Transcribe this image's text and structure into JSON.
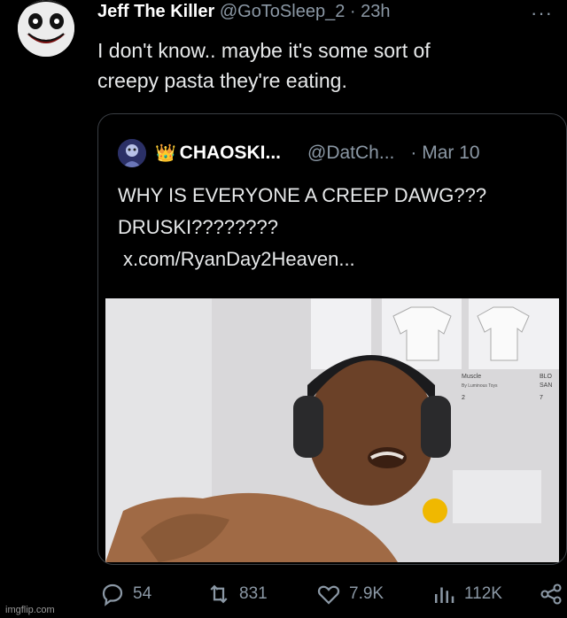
{
  "tweet": {
    "author_name": "Jeff The Killer",
    "author_handle": "@GoToSleep_2",
    "separator": "·",
    "time": "23h",
    "more_label": "···",
    "text_line1": "I don't know.. maybe it's some sort of",
    "text_line2": "creepy pasta they're eating."
  },
  "quote": {
    "author_name": "CHAOSKI...",
    "author_handle": "@DatCh...",
    "date": "· Mar 10",
    "crown": "👑",
    "text_line1": "WHY IS EVERYONE A CREEP DAWG???",
    "text_line2": "DRUSKI????????",
    "link": "x.com/RyanDay2Heaven...",
    "media_labels": {
      "item1": "Muscle",
      "item1_sub": "By Luminous Toys",
      "item2": "BLO",
      "item2_sub": "SAN",
      "price1": "2",
      "price2": "7"
    }
  },
  "actions": {
    "replies": "54",
    "reposts": "831",
    "likes": "7.9K",
    "views": "112K"
  },
  "watermark": "imgflip.com",
  "colors": {
    "background": "#000000",
    "text": "#e7e9ea",
    "muted": "#8b98a5",
    "border": "#3a3f44"
  }
}
